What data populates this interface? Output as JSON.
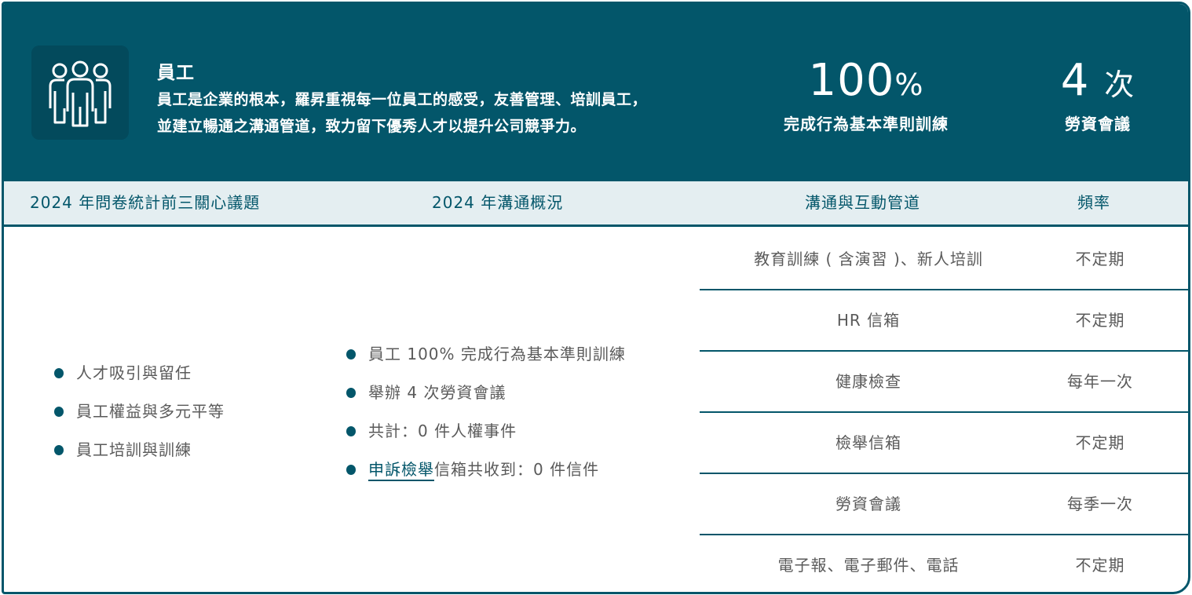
{
  "banner": {
    "icon": "people-group-icon",
    "title": "員工",
    "description_line1": "員工是企業的根本，羅昇重視每一位員工的感受，友善管理、培訓員工，",
    "description_line2": "並建立暢通之溝通管道，致力留下優秀人才以提升公司競爭力。",
    "stats": [
      {
        "value": "100",
        "unit": "%",
        "label": "完成行為基本準則訓練"
      },
      {
        "value": "4",
        "unit": "次",
        "label": "勞資會議"
      }
    ]
  },
  "table": {
    "headers": [
      "2024 年問卷統計前三關心議題",
      "2024 年溝通概況",
      "溝通與互動管道",
      "頻率"
    ],
    "concerns": [
      "人才吸引與留任",
      "員工權益與多元平等",
      "員工培訓與訓練"
    ],
    "overview": [
      "員工 100% 完成行為基本準則訓練",
      "舉辦 4 次勞資會議",
      "共計：0 件人權事件"
    ],
    "overview_link": {
      "link_text": "申訴檢舉",
      "rest_text": "信箱共收到：0 件信件"
    },
    "channels": [
      {
        "name": "教育訓練 ( 含演習 )、新人培訓",
        "frequency": "不定期"
      },
      {
        "name": "HR 信箱",
        "frequency": "不定期"
      },
      {
        "name": "健康檢查",
        "frequency": "每年一次"
      },
      {
        "name": "檢舉信箱",
        "frequency": "不定期"
      },
      {
        "name": "勞資會議",
        "frequency": "每季一次"
      },
      {
        "name": "電子報、電子郵件、電話",
        "frequency": "不定期"
      }
    ]
  },
  "colors": {
    "primary": "#03566a",
    "header_bg": "#e4eef1",
    "text": "#5a5a5a"
  }
}
